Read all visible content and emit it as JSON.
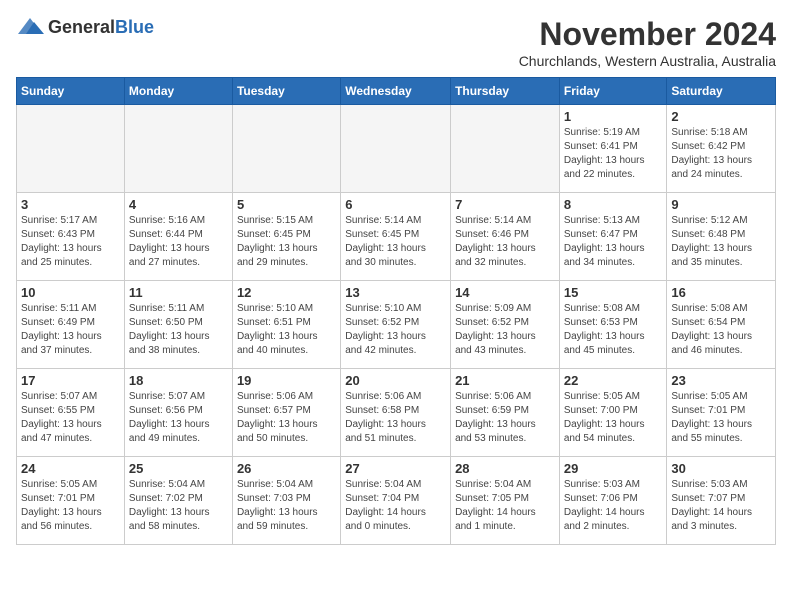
{
  "logo": {
    "general": "General",
    "blue": "Blue"
  },
  "title": "November 2024",
  "location": "Churchlands, Western Australia, Australia",
  "days_of_week": [
    "Sunday",
    "Monday",
    "Tuesday",
    "Wednesday",
    "Thursday",
    "Friday",
    "Saturday"
  ],
  "weeks": [
    [
      {
        "day": "",
        "info": ""
      },
      {
        "day": "",
        "info": ""
      },
      {
        "day": "",
        "info": ""
      },
      {
        "day": "",
        "info": ""
      },
      {
        "day": "",
        "info": ""
      },
      {
        "day": "1",
        "info": "Sunrise: 5:19 AM\nSunset: 6:41 PM\nDaylight: 13 hours\nand 22 minutes."
      },
      {
        "day": "2",
        "info": "Sunrise: 5:18 AM\nSunset: 6:42 PM\nDaylight: 13 hours\nand 24 minutes."
      }
    ],
    [
      {
        "day": "3",
        "info": "Sunrise: 5:17 AM\nSunset: 6:43 PM\nDaylight: 13 hours\nand 25 minutes."
      },
      {
        "day": "4",
        "info": "Sunrise: 5:16 AM\nSunset: 6:44 PM\nDaylight: 13 hours\nand 27 minutes."
      },
      {
        "day": "5",
        "info": "Sunrise: 5:15 AM\nSunset: 6:45 PM\nDaylight: 13 hours\nand 29 minutes."
      },
      {
        "day": "6",
        "info": "Sunrise: 5:14 AM\nSunset: 6:45 PM\nDaylight: 13 hours\nand 30 minutes."
      },
      {
        "day": "7",
        "info": "Sunrise: 5:14 AM\nSunset: 6:46 PM\nDaylight: 13 hours\nand 32 minutes."
      },
      {
        "day": "8",
        "info": "Sunrise: 5:13 AM\nSunset: 6:47 PM\nDaylight: 13 hours\nand 34 minutes."
      },
      {
        "day": "9",
        "info": "Sunrise: 5:12 AM\nSunset: 6:48 PM\nDaylight: 13 hours\nand 35 minutes."
      }
    ],
    [
      {
        "day": "10",
        "info": "Sunrise: 5:11 AM\nSunset: 6:49 PM\nDaylight: 13 hours\nand 37 minutes."
      },
      {
        "day": "11",
        "info": "Sunrise: 5:11 AM\nSunset: 6:50 PM\nDaylight: 13 hours\nand 38 minutes."
      },
      {
        "day": "12",
        "info": "Sunrise: 5:10 AM\nSunset: 6:51 PM\nDaylight: 13 hours\nand 40 minutes."
      },
      {
        "day": "13",
        "info": "Sunrise: 5:10 AM\nSunset: 6:52 PM\nDaylight: 13 hours\nand 42 minutes."
      },
      {
        "day": "14",
        "info": "Sunrise: 5:09 AM\nSunset: 6:52 PM\nDaylight: 13 hours\nand 43 minutes."
      },
      {
        "day": "15",
        "info": "Sunrise: 5:08 AM\nSunset: 6:53 PM\nDaylight: 13 hours\nand 45 minutes."
      },
      {
        "day": "16",
        "info": "Sunrise: 5:08 AM\nSunset: 6:54 PM\nDaylight: 13 hours\nand 46 minutes."
      }
    ],
    [
      {
        "day": "17",
        "info": "Sunrise: 5:07 AM\nSunset: 6:55 PM\nDaylight: 13 hours\nand 47 minutes."
      },
      {
        "day": "18",
        "info": "Sunrise: 5:07 AM\nSunset: 6:56 PM\nDaylight: 13 hours\nand 49 minutes."
      },
      {
        "day": "19",
        "info": "Sunrise: 5:06 AM\nSunset: 6:57 PM\nDaylight: 13 hours\nand 50 minutes."
      },
      {
        "day": "20",
        "info": "Sunrise: 5:06 AM\nSunset: 6:58 PM\nDaylight: 13 hours\nand 51 minutes."
      },
      {
        "day": "21",
        "info": "Sunrise: 5:06 AM\nSunset: 6:59 PM\nDaylight: 13 hours\nand 53 minutes."
      },
      {
        "day": "22",
        "info": "Sunrise: 5:05 AM\nSunset: 7:00 PM\nDaylight: 13 hours\nand 54 minutes."
      },
      {
        "day": "23",
        "info": "Sunrise: 5:05 AM\nSunset: 7:01 PM\nDaylight: 13 hours\nand 55 minutes."
      }
    ],
    [
      {
        "day": "24",
        "info": "Sunrise: 5:05 AM\nSunset: 7:01 PM\nDaylight: 13 hours\nand 56 minutes."
      },
      {
        "day": "25",
        "info": "Sunrise: 5:04 AM\nSunset: 7:02 PM\nDaylight: 13 hours\nand 58 minutes."
      },
      {
        "day": "26",
        "info": "Sunrise: 5:04 AM\nSunset: 7:03 PM\nDaylight: 13 hours\nand 59 minutes."
      },
      {
        "day": "27",
        "info": "Sunrise: 5:04 AM\nSunset: 7:04 PM\nDaylight: 14 hours\nand 0 minutes."
      },
      {
        "day": "28",
        "info": "Sunrise: 5:04 AM\nSunset: 7:05 PM\nDaylight: 14 hours\nand 1 minute."
      },
      {
        "day": "29",
        "info": "Sunrise: 5:03 AM\nSunset: 7:06 PM\nDaylight: 14 hours\nand 2 minutes."
      },
      {
        "day": "30",
        "info": "Sunrise: 5:03 AM\nSunset: 7:07 PM\nDaylight: 14 hours\nand 3 minutes."
      }
    ]
  ]
}
